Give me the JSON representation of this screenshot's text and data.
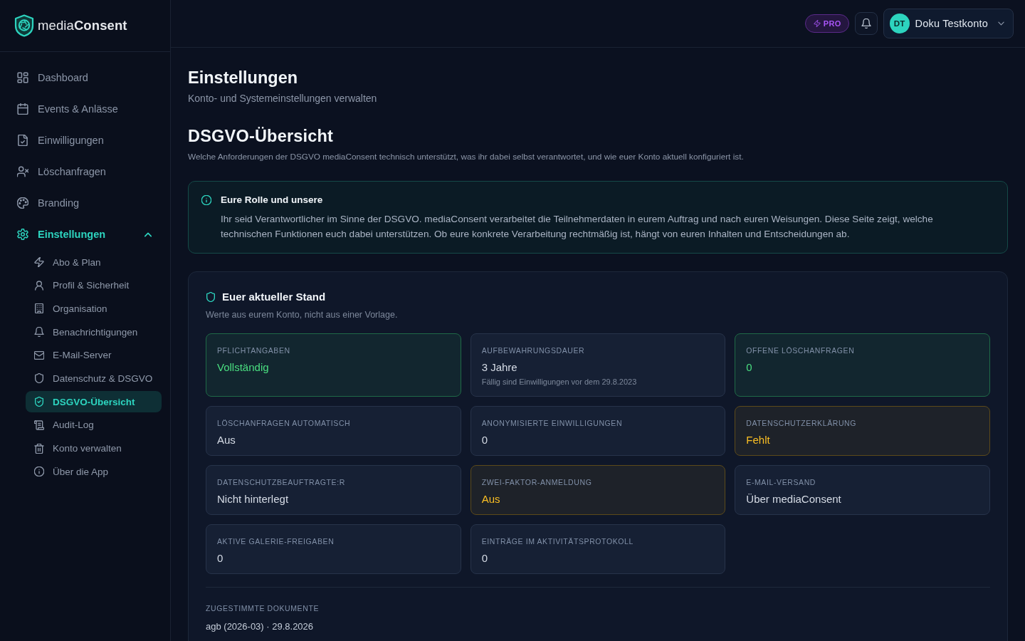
{
  "sidebar": {
    "logo": {
      "text": "media**Consent**"
    },
    "nav": [
      {
        "label": "Dashboard",
        "selected": false
      },
      {
        "label": "Events & Anlässe",
        "selected": false
      },
      {
        "label": "Einwilligungen",
        "selected": false
      },
      {
        "label": "Löschanfragen",
        "selected": false
      },
      {
        "label": "Branding",
        "selected": false
      },
      {
        "label": "Einstellungen",
        "selected": true,
        "expanded": true,
        "children": [
          {
            "label": "Abo & Plan",
            "selected": false
          },
          {
            "label": "Profil & Sicherheit",
            "selected": false
          },
          {
            "label": "Organisation",
            "selected": false
          },
          {
            "label": "Benachrichtigungen",
            "selected": false
          },
          {
            "label": "E-Mail-Server",
            "selected": false
          },
          {
            "label": "Datenschutz & DSGVO",
            "selected": false
          },
          {
            "label": "DSGVO-Übersicht",
            "selected": true
          },
          {
            "label": "Audit-Log",
            "selected": false
          },
          {
            "label": "Konto verwalten",
            "selected": false
          },
          {
            "label": "Über die App",
            "selected": false
          }
        ]
      }
    ]
  },
  "header": {
    "plan_badge": "PRO",
    "user": {
      "initials": "DT",
      "name": "Doku Testkonto"
    }
  },
  "page": {
    "title": "Einstellungen",
    "subtitle": "Konto- und Systemeinstellungen verwalten"
  },
  "section": {
    "title": "DSGVO-Übersicht",
    "description": "Welche Anforderungen der DSGVO mediaConsent technisch unterstützt, was ihr dabei selbst verantwortet, und wie euer Konto aktuell konfiguriert ist."
  },
  "info_box": {
    "title": "Eure Rolle und unsere",
    "text": "Ihr seid Verantwortlicher im Sinne der DSGVO. mediaConsent verarbeitet die Teilnehmerdaten in eurem Auftrag und nach euren Weisungen. Diese Seite zeigt, welche technischen Funktionen euch dabei unterstützen. Ob eure konkrete Verarbeitung rechtmäßig ist, hängt von euren Inhalten und Entscheidungen ab."
  },
  "status_panel": {
    "title": "Euer aktueller Stand",
    "subtitle": "Werte aus eurem Konto, nicht aus einer Vorlage.",
    "tiles": [
      {
        "kind": "ok",
        "label": "PFLICHTANGABEN",
        "value": "Vollständig"
      },
      {
        "kind": "plain",
        "label": "AUFBEWAHRUNGSDAUER",
        "value": "3 Jahre",
        "note": "Fällig sind Einwilligungen vor dem 29.8.2023"
      },
      {
        "kind": "ok",
        "label": "OFFENE LÖSCHANFRAGEN",
        "value": "0"
      },
      {
        "kind": "plain",
        "label": "LÖSCHANFRAGEN AUTOMATISCH",
        "value": "Aus"
      },
      {
        "kind": "plain",
        "label": "ANONYMISIERTE EINWILLIGUNGEN",
        "value": "0"
      },
      {
        "kind": "warning",
        "label": "DATENSCHUTZERKLÄRUNG",
        "value": "Fehlt"
      },
      {
        "kind": "plain",
        "label": "DATENSCHUTZBEAUFTRAGTE:R",
        "value": "Nicht hinterlegt"
      },
      {
        "kind": "warning",
        "label": "ZWEI-FAKTOR-ANMELDUNG",
        "value": "Aus"
      },
      {
        "kind": "plain",
        "label": "E-MAIL-VERSAND",
        "value": "Über mediaConsent"
      },
      {
        "kind": "plain",
        "label": "AKTIVE GALERIE-FREIGABEN",
        "value": "0"
      },
      {
        "kind": "plain",
        "label": "EINTRÄGE IM AKTIVITÄTSPROTOKOLL",
        "value": "0"
      }
    ],
    "documents": {
      "label": "ZUGESTIMMTE DOKUMENTE",
      "items": [
        "agb (2026-03) · 29.8.2026"
      ]
    }
  }
}
